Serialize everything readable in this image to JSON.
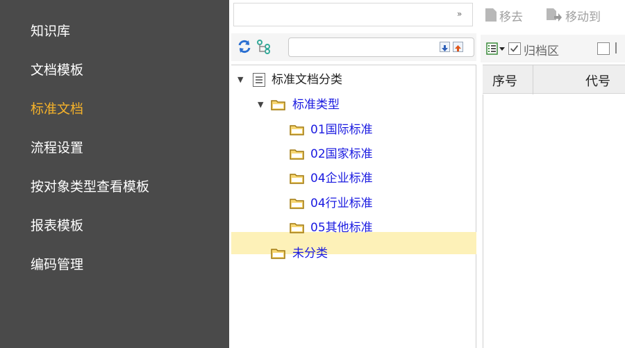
{
  "sidebar": {
    "items": [
      {
        "label": "知识库",
        "active": false
      },
      {
        "label": "文档模板",
        "active": false
      },
      {
        "label": "标准文档",
        "active": true
      },
      {
        "label": "流程设置",
        "active": false
      },
      {
        "label": "按对象类型查看模板",
        "active": false
      },
      {
        "label": "报表模板",
        "active": false
      },
      {
        "label": "编码管理",
        "active": false
      }
    ]
  },
  "tree_panel": {
    "search": {
      "value": "",
      "placeholder": ""
    },
    "icons": [
      "chevrons-down-icon",
      "refresh-icon",
      "tree-structure-icon",
      "sort-down-icon",
      "sort-up-icon"
    ],
    "tree": {
      "root": "标准文档分类",
      "type_node": "标准类型",
      "children": [
        "01国际标准",
        "02国家标准",
        "04企业标准",
        "04行业标准",
        "05其他标准"
      ],
      "selected": "04企业标准",
      "uncategorized": "未分类"
    }
  },
  "right_panel": {
    "toolbar": {
      "remove_label": "移去",
      "move_to_label": "移动到",
      "archive_label": "归档区",
      "archive_checked": true
    },
    "table": {
      "columns": [
        "序号",
        "代号"
      ]
    }
  },
  "colors": {
    "sidebar_bg": "#4a4a4a",
    "accent": "#f5b22a",
    "selection": "#fdf1b8",
    "link_blue": "#1a1ae0"
  }
}
